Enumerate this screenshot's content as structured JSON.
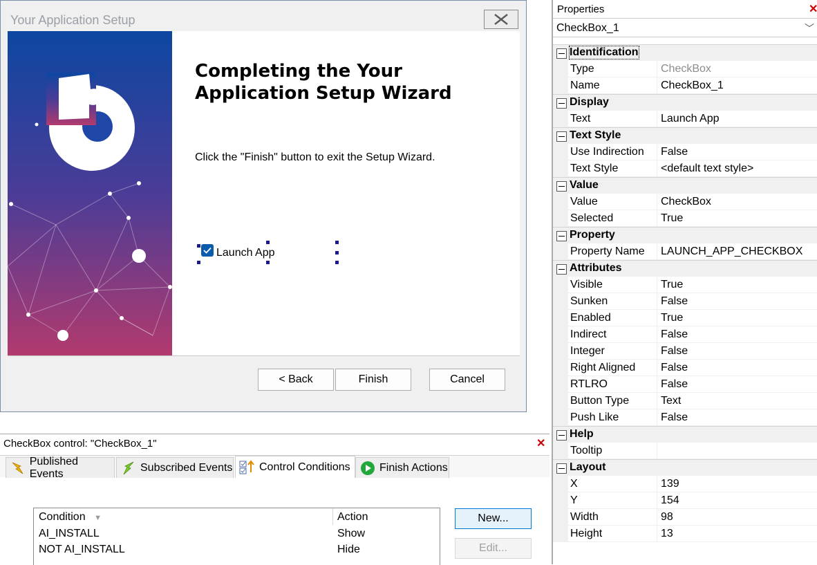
{
  "wizard": {
    "title": "Your Application Setup",
    "heading": "Completing the Your Application Setup Wizard",
    "description": "Click the \"Finish\" button to exit the Setup Wizard.",
    "checkbox_label": "Launch App",
    "checkbox_checked": true,
    "buttons": {
      "back": "< Back",
      "finish": "Finish",
      "cancel": "Cancel"
    },
    "banner_colors": {
      "top": "#0d47a1",
      "mid": "#4a3c97",
      "bottom": "#b23a6e"
    }
  },
  "properties": {
    "title": "Properties",
    "selected_object": "CheckBox_1",
    "categories": [
      {
        "name": "Identification",
        "rows": [
          {
            "name": "Type",
            "value": "CheckBox",
            "readonly": true
          },
          {
            "name": "Name",
            "value": "CheckBox_1"
          }
        ]
      },
      {
        "name": "Display",
        "rows": [
          {
            "name": "Text",
            "value": "Launch App"
          }
        ]
      },
      {
        "name": "Text Style",
        "rows": [
          {
            "name": "Use Indirection",
            "value": "False"
          },
          {
            "name": "Text Style",
            "value": "<default text style>"
          }
        ]
      },
      {
        "name": "Value",
        "rows": [
          {
            "name": "Value",
            "value": "CheckBox"
          },
          {
            "name": "Selected",
            "value": "True"
          }
        ]
      },
      {
        "name": "Property",
        "rows": [
          {
            "name": "Property Name",
            "value": "LAUNCH_APP_CHECKBOX"
          }
        ]
      },
      {
        "name": "Attributes",
        "rows": [
          {
            "name": "Visible",
            "value": "True"
          },
          {
            "name": "Sunken",
            "value": "False"
          },
          {
            "name": "Enabled",
            "value": "True"
          },
          {
            "name": "Indirect",
            "value": "False"
          },
          {
            "name": "Integer",
            "value": "False"
          },
          {
            "name": "Right Aligned",
            "value": "False"
          },
          {
            "name": "RTLRO",
            "value": "False"
          },
          {
            "name": "Button Type",
            "value": "Text"
          },
          {
            "name": "Push Like",
            "value": "False"
          }
        ]
      },
      {
        "name": "Help",
        "rows": [
          {
            "name": "Tooltip",
            "value": ""
          }
        ]
      },
      {
        "name": "Layout",
        "rows": [
          {
            "name": "X",
            "value": "139"
          },
          {
            "name": "Y",
            "value": "154"
          },
          {
            "name": "Width",
            "value": "98"
          },
          {
            "name": "Height",
            "value": "13"
          }
        ]
      }
    ]
  },
  "bottom_panel": {
    "title": "CheckBox control: \"CheckBox_1\"",
    "tabs": [
      {
        "label": "Published Events",
        "icon": "lightning-icon"
      },
      {
        "label": "Subscribed Events",
        "icon": "lightning-green-icon"
      },
      {
        "label": "Control Conditions",
        "icon": "conditions-icon",
        "active": true
      },
      {
        "label": "Finish Actions",
        "icon": "play-icon"
      }
    ],
    "conditions": {
      "columns": [
        "Condition",
        "Action"
      ],
      "rows": [
        {
          "condition": "AI_INSTALL",
          "action": "Show"
        },
        {
          "condition": "NOT AI_INSTALL",
          "action": "Hide"
        }
      ]
    },
    "buttons": {
      "new": "New...",
      "edit": "Edit..."
    }
  }
}
